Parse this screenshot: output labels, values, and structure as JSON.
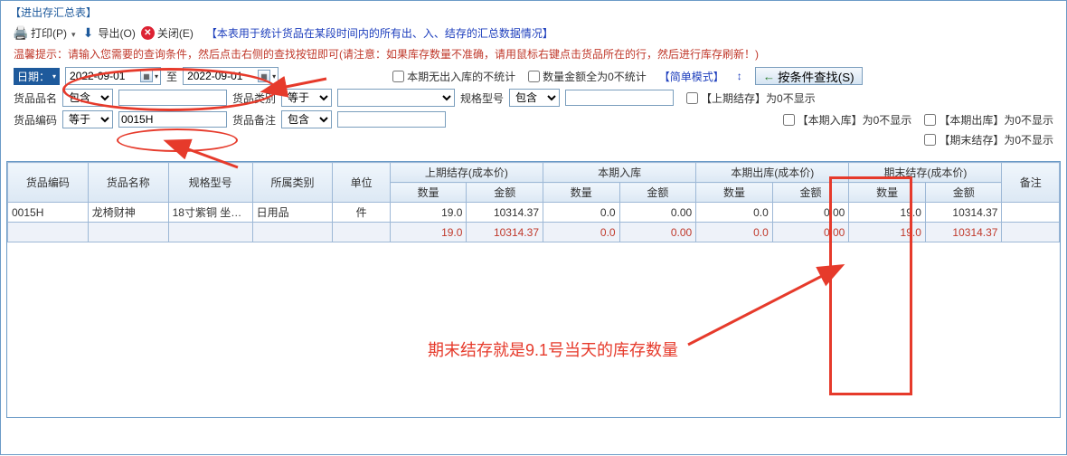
{
  "title": "【进出存汇总表】",
  "toolbar": {
    "print": "打印(P)",
    "export": "导出(O)",
    "close": "关闭(E)",
    "desc": "【本表用于统计货品在某段时间内的所有出、入、结存的汇总数据情况】"
  },
  "hint": "温馨提示：请输入您需要的查询条件，然后点击右侧的查找按钮即可(请注意：如果库存数量不准确，请用鼠标右键点击货品所在的行，然后进行库存刷新！)",
  "filters": {
    "date_label": "日期：",
    "date_from": "2022-09-01",
    "date_to_sep": "至",
    "date_to": "2022-09-01",
    "no_inout_label": "本期无出入库的不统计",
    "zero_amount_label": "数量金额全为0不统计",
    "simple_mode": "【简单模式】",
    "search_btn": "按条件查找(S)",
    "product_name_label": "货品品名",
    "op_contains": "包含",
    "product_name_value": "",
    "category_label": "货品类别",
    "op_equals": "等于",
    "spec_label": "规格型号",
    "last_stock_hide": "【上期结存】为0不显示",
    "product_code_label": "货品编码",
    "product_code_value": "0015H",
    "remark_label": "货品备注",
    "in_hide": "【本期入库】为0不显示",
    "out_hide": "【本期出库】为0不显示",
    "end_hide": "【期末结存】为0不显示"
  },
  "table": {
    "headers": {
      "code": "货品编码",
      "name": "货品名称",
      "spec": "规格型号",
      "category": "所属类别",
      "unit": "单位",
      "last_stock": "上期结存(成本价)",
      "in_period": "本期入库",
      "out_period": "本期出库(成本价)",
      "end_stock": "期末结存(成本价)",
      "remark": "备注",
      "qty": "数量",
      "amount": "金额"
    },
    "rows": [
      {
        "code": "0015H",
        "name": "龙椅财神",
        "spec": "18寸紫铜 坐…",
        "category": "日用品",
        "unit": "件",
        "last_qty": "19.0",
        "last_amt": "10314.37",
        "in_qty": "0.0",
        "in_amt": "0.00",
        "out_qty": "0.0",
        "out_amt": "0.00",
        "end_qty": "19.0",
        "end_amt": "10314.37"
      }
    ],
    "totals": {
      "last_qty": "19.0",
      "last_amt": "10314.37",
      "in_qty": "0.0",
      "in_amt": "0.00",
      "out_qty": "0.0",
      "out_amt": "0.00",
      "end_qty": "19.0",
      "end_amt": "10314.37"
    }
  },
  "annotation": {
    "text": "期末结存就是9.1号当天的库存数量"
  }
}
